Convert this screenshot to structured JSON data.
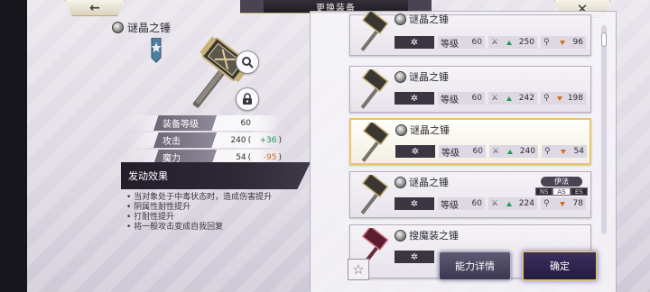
{
  "header": {
    "title": "更换装备",
    "back_icon": "←",
    "close_icon": "✕"
  },
  "detail": {
    "name": "谜晶之锤",
    "stats": [
      {
        "label": "装备等级",
        "value": "60",
        "paren_open": "",
        "diff": "",
        "paren_close": "",
        "trend": ""
      },
      {
        "label": "攻击",
        "value": "240",
        "paren_open": "(",
        "diff": "+36",
        "paren_close": ")",
        "trend": "up"
      },
      {
        "label": "魔力",
        "value": "54",
        "paren_open": "(",
        "diff": "-95",
        "paren_close": ")",
        "trend": "down"
      }
    ],
    "effect_title": "发动效果",
    "effects": [
      "• 当对象处于中毒状态时，造成伤害提升",
      "• 阴属性耐性提升",
      "• 打耐性提升",
      "• 将一般攻击变成自我回复"
    ]
  },
  "list": {
    "level_label": "等级",
    "spark": "✲",
    "items": [
      {
        "name": "谜晶之锤",
        "level": "60",
        "atk": "250",
        "atk_trend": "up",
        "mag": "96",
        "mag_trend": "down"
      },
      {
        "name": "谜晶之锤",
        "level": "60",
        "atk": "242",
        "atk_trend": "up",
        "mag": "198",
        "mag_trend": "down"
      },
      {
        "name": "谜晶之锤",
        "level": "60",
        "atk": "240",
        "atk_trend": "up",
        "mag": "54",
        "mag_trend": "down",
        "selected": true
      },
      {
        "name": "谜晶之锤",
        "level": "60",
        "atk": "224",
        "atk_trend": "up",
        "mag": "78",
        "mag_trend": "down",
        "equipper": {
          "name": "伊法",
          "tags": [
            "NS",
            "AS",
            "ES"
          ],
          "active_tag": "AS"
        }
      },
      {
        "name": "搜魔装之锤",
        "level": "",
        "atk": "",
        "mag": ""
      }
    ]
  },
  "buttons": {
    "detail": "能力详情",
    "confirm": "确定",
    "favorite_icon": "☆"
  },
  "colors": {
    "up": "#1f9a5a",
    "down": "#d66a1a",
    "selected_border": "#e8c66a"
  }
}
